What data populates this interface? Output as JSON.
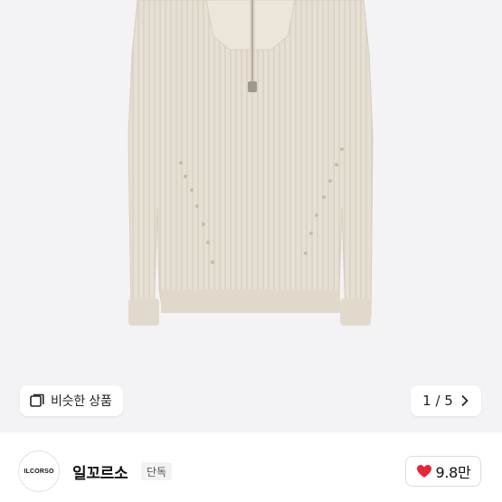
{
  "product": {
    "image_alt": "sweater-image"
  },
  "similar": {
    "label": "비슷한 상품",
    "icon": "similar-items-icon"
  },
  "pager": {
    "text": "1 / 5",
    "current": 1,
    "total": 5
  },
  "shop": {
    "logo_text": "ILCORSO",
    "name": "일꼬르소",
    "badge": "단독"
  },
  "like": {
    "count": "9.8만",
    "icon": "heart-icon",
    "color": "#e8253b"
  }
}
